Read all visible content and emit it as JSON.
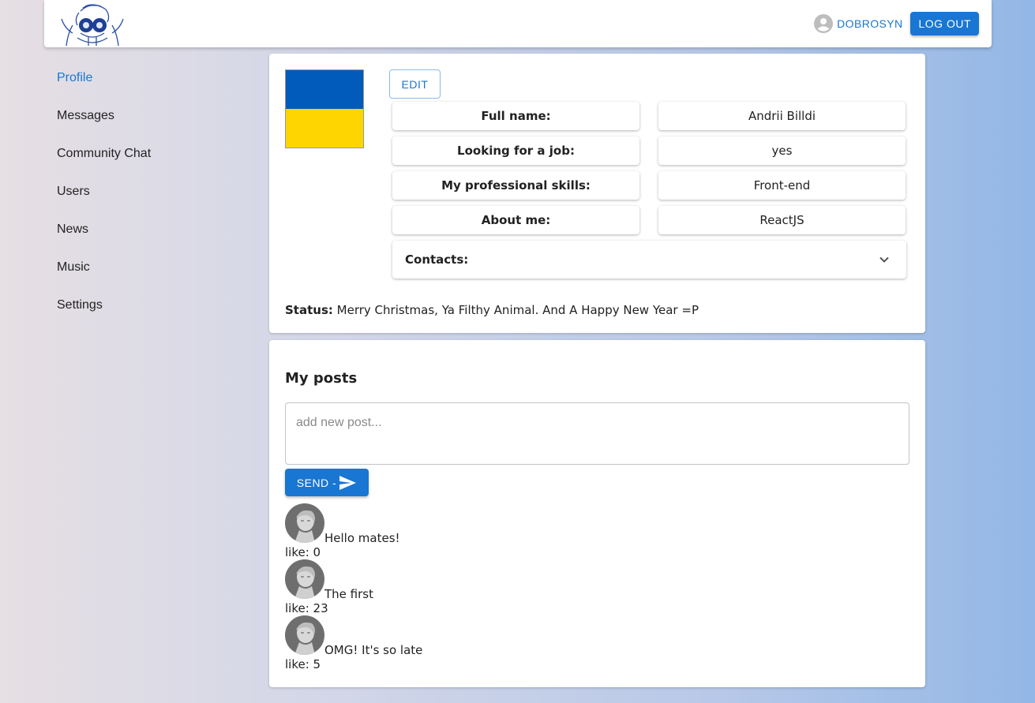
{
  "header": {
    "username": "DOBROSYN",
    "logout_label": "LOG OUT"
  },
  "sidebar": {
    "items": [
      {
        "label": "Profile",
        "active": true
      },
      {
        "label": "Messages"
      },
      {
        "label": "Community Chat"
      },
      {
        "label": "Users"
      },
      {
        "label": "News"
      },
      {
        "label": "Music"
      },
      {
        "label": "Settings"
      }
    ]
  },
  "profile": {
    "edit_label": "EDIT",
    "rows": [
      {
        "label": "Full name:",
        "value": "Andrii Billdi"
      },
      {
        "label": "Looking for a job:",
        "value": "yes"
      },
      {
        "label": "My professional skills:",
        "value": "Front-end"
      },
      {
        "label": "About me:",
        "value": "ReactJS"
      }
    ],
    "contacts_label": "Contacts:",
    "status_label": "Status:",
    "status_text": "Merry Christmas, Ya Filthy Animal. And A Happy New Year =P",
    "flag_colors": {
      "top": "#005bbb",
      "bottom": "#ffd500"
    }
  },
  "posts": {
    "title": "My posts",
    "placeholder": "add new post...",
    "send_label": "SEND -",
    "items": [
      {
        "text": "Hello mates!",
        "likes": "like: 0"
      },
      {
        "text": "The first",
        "likes": "like: 23"
      },
      {
        "text": "OMG! It's so late",
        "likes": "like: 5"
      }
    ]
  },
  "colors": {
    "accent": "#1976d2"
  }
}
